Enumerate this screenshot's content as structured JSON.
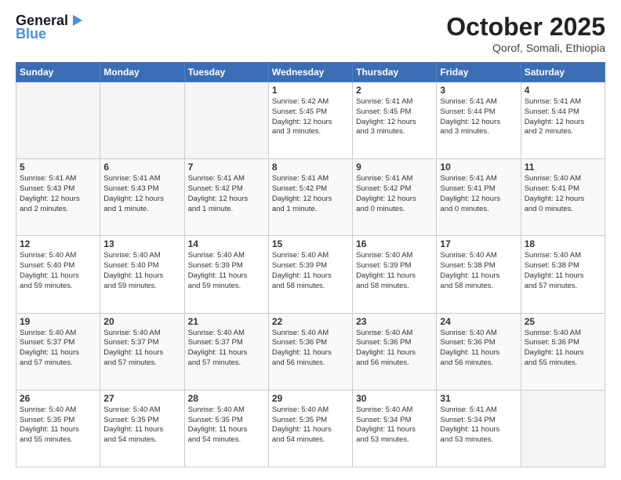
{
  "header": {
    "logo_line1": "General",
    "logo_line2": "Blue",
    "title": "October 2025",
    "subtitle": "Qorof, Somali, Ethiopia"
  },
  "weekdays": [
    "Sunday",
    "Monday",
    "Tuesday",
    "Wednesday",
    "Thursday",
    "Friday",
    "Saturday"
  ],
  "weeks": [
    [
      {
        "day": "",
        "info": ""
      },
      {
        "day": "",
        "info": ""
      },
      {
        "day": "",
        "info": ""
      },
      {
        "day": "1",
        "info": "Sunrise: 5:42 AM\nSunset: 5:45 PM\nDaylight: 12 hours\nand 3 minutes."
      },
      {
        "day": "2",
        "info": "Sunrise: 5:41 AM\nSunset: 5:45 PM\nDaylight: 12 hours\nand 3 minutes."
      },
      {
        "day": "3",
        "info": "Sunrise: 5:41 AM\nSunset: 5:44 PM\nDaylight: 12 hours\nand 3 minutes."
      },
      {
        "day": "4",
        "info": "Sunrise: 5:41 AM\nSunset: 5:44 PM\nDaylight: 12 hours\nand 2 minutes."
      }
    ],
    [
      {
        "day": "5",
        "info": "Sunrise: 5:41 AM\nSunset: 5:43 PM\nDaylight: 12 hours\nand 2 minutes."
      },
      {
        "day": "6",
        "info": "Sunrise: 5:41 AM\nSunset: 5:43 PM\nDaylight: 12 hours\nand 1 minute."
      },
      {
        "day": "7",
        "info": "Sunrise: 5:41 AM\nSunset: 5:42 PM\nDaylight: 12 hours\nand 1 minute."
      },
      {
        "day": "8",
        "info": "Sunrise: 5:41 AM\nSunset: 5:42 PM\nDaylight: 12 hours\nand 1 minute."
      },
      {
        "day": "9",
        "info": "Sunrise: 5:41 AM\nSunset: 5:42 PM\nDaylight: 12 hours\nand 0 minutes."
      },
      {
        "day": "10",
        "info": "Sunrise: 5:41 AM\nSunset: 5:41 PM\nDaylight: 12 hours\nand 0 minutes."
      },
      {
        "day": "11",
        "info": "Sunrise: 5:40 AM\nSunset: 5:41 PM\nDaylight: 12 hours\nand 0 minutes."
      }
    ],
    [
      {
        "day": "12",
        "info": "Sunrise: 5:40 AM\nSunset: 5:40 PM\nDaylight: 11 hours\nand 59 minutes."
      },
      {
        "day": "13",
        "info": "Sunrise: 5:40 AM\nSunset: 5:40 PM\nDaylight: 11 hours\nand 59 minutes."
      },
      {
        "day": "14",
        "info": "Sunrise: 5:40 AM\nSunset: 5:39 PM\nDaylight: 11 hours\nand 59 minutes."
      },
      {
        "day": "15",
        "info": "Sunrise: 5:40 AM\nSunset: 5:39 PM\nDaylight: 11 hours\nand 58 minutes."
      },
      {
        "day": "16",
        "info": "Sunrise: 5:40 AM\nSunset: 5:39 PM\nDaylight: 11 hours\nand 58 minutes."
      },
      {
        "day": "17",
        "info": "Sunrise: 5:40 AM\nSunset: 5:38 PM\nDaylight: 11 hours\nand 58 minutes."
      },
      {
        "day": "18",
        "info": "Sunrise: 5:40 AM\nSunset: 5:38 PM\nDaylight: 11 hours\nand 57 minutes."
      }
    ],
    [
      {
        "day": "19",
        "info": "Sunrise: 5:40 AM\nSunset: 5:37 PM\nDaylight: 11 hours\nand 57 minutes."
      },
      {
        "day": "20",
        "info": "Sunrise: 5:40 AM\nSunset: 5:37 PM\nDaylight: 11 hours\nand 57 minutes."
      },
      {
        "day": "21",
        "info": "Sunrise: 5:40 AM\nSunset: 5:37 PM\nDaylight: 11 hours\nand 57 minutes."
      },
      {
        "day": "22",
        "info": "Sunrise: 5:40 AM\nSunset: 5:36 PM\nDaylight: 11 hours\nand 56 minutes."
      },
      {
        "day": "23",
        "info": "Sunrise: 5:40 AM\nSunset: 5:36 PM\nDaylight: 11 hours\nand 56 minutes."
      },
      {
        "day": "24",
        "info": "Sunrise: 5:40 AM\nSunset: 5:36 PM\nDaylight: 11 hours\nand 56 minutes."
      },
      {
        "day": "25",
        "info": "Sunrise: 5:40 AM\nSunset: 5:36 PM\nDaylight: 11 hours\nand 55 minutes."
      }
    ],
    [
      {
        "day": "26",
        "info": "Sunrise: 5:40 AM\nSunset: 5:35 PM\nDaylight: 11 hours\nand 55 minutes."
      },
      {
        "day": "27",
        "info": "Sunrise: 5:40 AM\nSunset: 5:35 PM\nDaylight: 11 hours\nand 54 minutes."
      },
      {
        "day": "28",
        "info": "Sunrise: 5:40 AM\nSunset: 5:35 PM\nDaylight: 11 hours\nand 54 minutes."
      },
      {
        "day": "29",
        "info": "Sunrise: 5:40 AM\nSunset: 5:35 PM\nDaylight: 11 hours\nand 54 minutes."
      },
      {
        "day": "30",
        "info": "Sunrise: 5:40 AM\nSunset: 5:34 PM\nDaylight: 11 hours\nand 53 minutes."
      },
      {
        "day": "31",
        "info": "Sunrise: 5:41 AM\nSunset: 5:34 PM\nDaylight: 11 hours\nand 53 minutes."
      },
      {
        "day": "",
        "info": ""
      }
    ]
  ]
}
